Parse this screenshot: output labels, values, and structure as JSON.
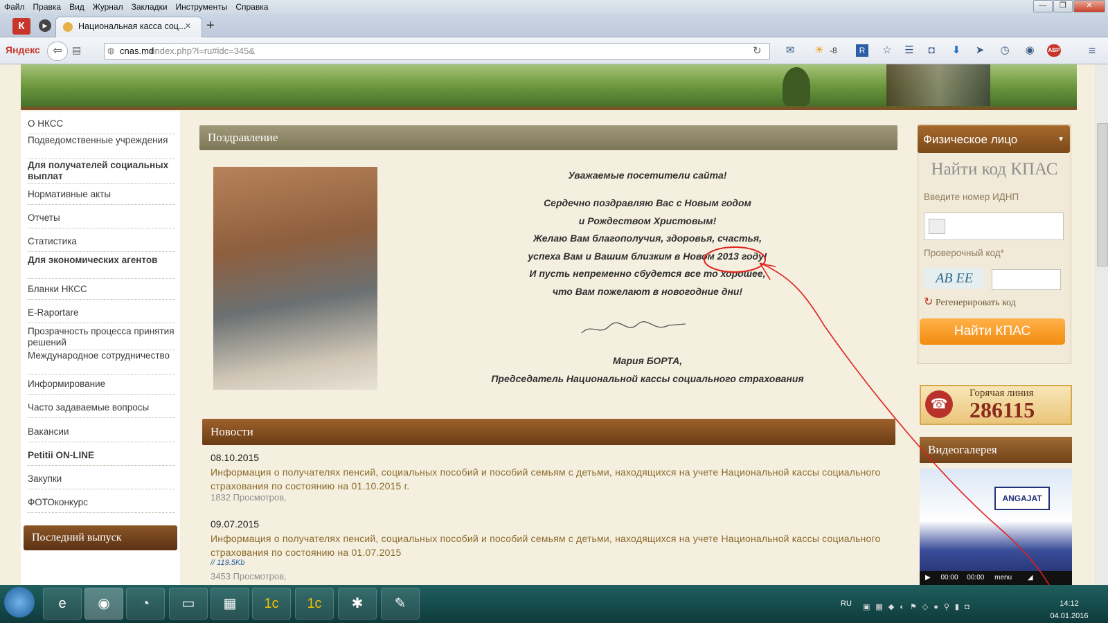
{
  "browser": {
    "menu": [
      "Файл",
      "Правка",
      "Вид",
      "Журнал",
      "Закладки",
      "Инструменты",
      "Справка"
    ],
    "tab_title": "Национальная касса соц...",
    "tab_close": "×",
    "new_tab": "+",
    "yandex_label": "Яндекс",
    "url_host": "cnas.md",
    "url_path": "/index.php?l=ru#idc=345&",
    "weather": "-8",
    "abp": "ABP",
    "win_min": "—",
    "win_max": "❐",
    "win_close": "✕"
  },
  "sidebar": {
    "items": [
      "О НКСС",
      "Подведомственные учреждения",
      "Для получателей социальных выплат",
      "Нормативные акты",
      "Отчеты",
      "Статистика",
      "Для экономических агентов",
      "Бланки НКСС",
      "E-Raportare",
      "Прозрачность процесса принятия решений",
      "Международное сотрудничество",
      "Информирование",
      "Часто задаваемые вопросы",
      "Вакансии",
      "Petitii ON-LINE",
      "Закупки",
      "ФОТОконкурс"
    ],
    "last_issue": "Последний выпуск"
  },
  "greeting": {
    "header": "Поздравление",
    "l1": "Уважаемые посетители сайта!",
    "l2": "Сердечно поздравляю Вас с Новым годом",
    "l3": "и Рождеством Христовым!",
    "l4": "Желаю Вам  благополучия, здоровья, счастья,",
    "l5": "успеха Вам и Вашим близким в Новом 2013 году!",
    "l6": "И пусть непременно сбудется все то хорошее,",
    "l7": "что Вам пожелают в новогодние дни!",
    "signer": "Мария БОРТА,",
    "signer_title": "Председатель Национальной кассы социального страхования"
  },
  "news": {
    "header": "Новости",
    "items": [
      {
        "date": "08.10.2015",
        "title": "Информация о получателях пенсий, социальных пособий и пособий семьям с детьми, находящихся на учете Национальной кассы социального страхования по состоянию на 01.10.2015 г.",
        "views": "1832 Просмотров,"
      },
      {
        "date": "09.07.2015",
        "title": "Информация о получателях пенсий, социальных пособий и пособий семьям с детьми, находящихся на учете Национальной кассы социального страхования по состоянию на 01.07.2015",
        "attachment": "// 119.5Kb",
        "views": "3453 Просмотров,"
      }
    ]
  },
  "right": {
    "person_dropdown": "Физическое лицо",
    "find_title": "Найти код КПАС",
    "idnp_label": "Введите номер ИДНП",
    "captcha_label": "Проверочный код*",
    "captcha_text": "AB EE",
    "regenerate": "Регенерировать код",
    "find_button": "Найти КПАС",
    "hotline_label": "Горячая линия",
    "hotline_number": "286115",
    "video_header": "Видеогалерея",
    "video_caption": "ANGAJAT",
    "video_time1": "00:00",
    "video_time2": "00:00",
    "video_menu": "menu"
  },
  "taskbar": {
    "lang": "RU",
    "time": "14:12",
    "date": "04.01.2016"
  }
}
